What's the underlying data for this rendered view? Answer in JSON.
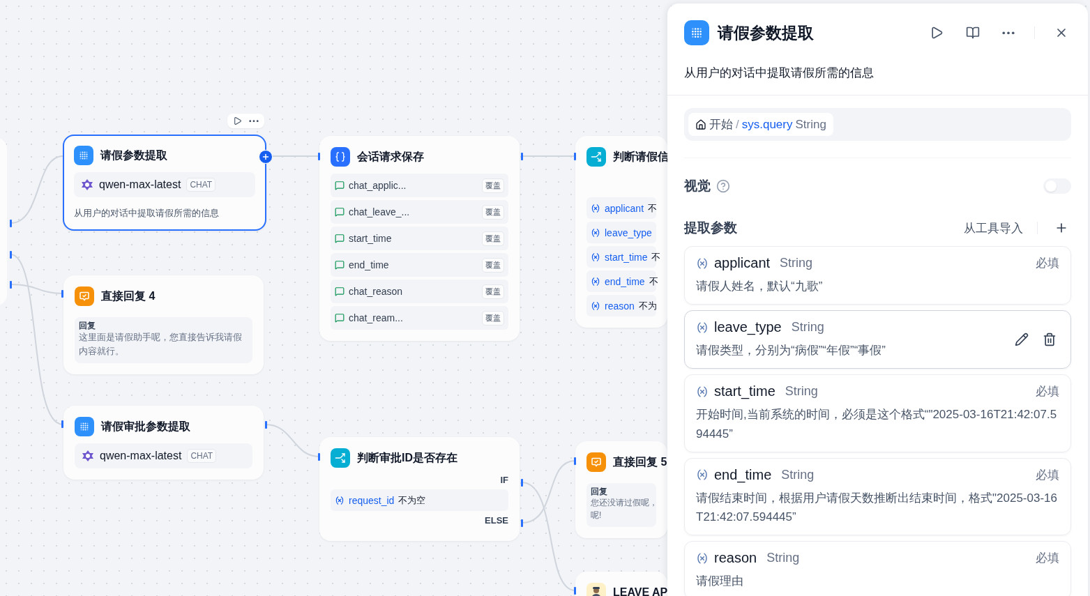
{
  "canvas": {
    "nodes": [
      {
        "kind": "llm",
        "title": "请假参数提取",
        "selected": true,
        "model": "qwen-max-latest",
        "mode": "CHAT",
        "description": "从用户的对话中提取请假所需的信息"
      },
      {
        "kind": "answer",
        "title": "直接回复 4",
        "selected": false,
        "reply_label": "回复",
        "reply_lines": [
          "这里面是请假助手呢，您直接告诉我请假内容就行。"
        ]
      },
      {
        "kind": "llm",
        "title": "请假审批参数提取",
        "selected": false,
        "model": "qwen-max-latest",
        "mode": "CHAT"
      },
      {
        "kind": "assigner",
        "title": "会话请求保存",
        "selected": false,
        "variables": [
          {
            "name": "chat_applic...",
            "action": "覆盖"
          },
          {
            "name": "chat_leave_...",
            "action": "覆盖"
          },
          {
            "name": "start_time",
            "action": "覆盖"
          },
          {
            "name": "end_time",
            "action": "覆盖"
          },
          {
            "name": "chat_reason",
            "action": "覆盖"
          },
          {
            "name": "chat_ream...",
            "action": "覆盖"
          }
        ]
      },
      {
        "kind": "if",
        "title": "判断请假信",
        "selected": false,
        "conditions": [
          {
            "variable": "applicant",
            "operator": "不"
          },
          {
            "variable": "leave_type"
          },
          {
            "variable": "start_time",
            "operator": "不"
          },
          {
            "variable": "end_time",
            "operator": "不"
          },
          {
            "variable": "reason",
            "operator": "不为"
          }
        ]
      },
      {
        "kind": "if",
        "title": "判断审批ID是否存在",
        "selected": false,
        "if_label": "IF",
        "conditions": [
          {
            "variable": "request_id",
            "operator": "不为空"
          }
        ],
        "else_label": "ELSE"
      },
      {
        "kind": "answer",
        "title": "直接回复 5",
        "selected": false,
        "reply_label": "回复",
        "reply_lines": [
          "您还没请过假呢，",
          "呢!"
        ]
      },
      {
        "kind": "agent",
        "title": "LEAVE AP",
        "selected": false
      }
    ]
  },
  "panel": {
    "title": "请假参数提取",
    "description": "从用户的对话中提取请假所需的信息",
    "input_var": {
      "node": "开始",
      "separator": "/",
      "variable": "sys.query",
      "type": "String"
    },
    "vision": {
      "label": "视觉",
      "on": false
    },
    "params_section": {
      "title": "提取参数",
      "import_label": "从工具导入"
    },
    "params": [
      {
        "name": "applicant",
        "type": "String",
        "tag": "必填",
        "description": "请假人姓名，默认“九歌”",
        "hovered": false
      },
      {
        "name": "leave_type",
        "type": "String",
        "description": "请假类型，分别为“病假”“年假”“事假”",
        "hovered": true
      },
      {
        "name": "start_time",
        "type": "String",
        "tag": "必填",
        "description": "开始时间,当前系统的时间，必须是这个格式“\"2025-03-16T21:42:07.594445”",
        "hovered": false
      },
      {
        "name": "end_time",
        "type": "String",
        "tag": "必填",
        "description": "请假结束时间，根据用户请假天数推断出结束时间，格式\"2025-03-16T21:42:07.594445”",
        "hovered": false
      },
      {
        "name": "reason",
        "type": "String",
        "tag": "必填",
        "description": "请假理由",
        "hovered": false
      }
    ]
  }
}
